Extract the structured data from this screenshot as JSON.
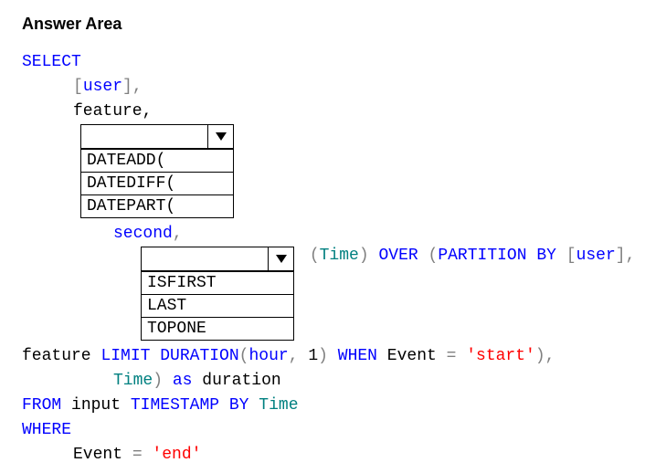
{
  "heading": "Answer Area",
  "sql": {
    "select": "SELECT",
    "user_bracket_open": "[",
    "user_word": "user",
    "user_bracket_close": "]",
    "comma": ",",
    "feature_line": "feature,",
    "second_word": "second",
    "paren_open": "(",
    "time_word": "Time",
    "paren_close": ")",
    "over": "OVER",
    "partition_by": "PARTITION BY",
    "feature_word": "feature",
    "limit_duration": "LIMIT DURATION",
    "hour_word": "hour",
    "one": "1",
    "when": "WHEN",
    "event_word": "Event",
    "equals": " = ",
    "start_str": "'start'",
    "time_as_duration_time": "Time",
    "as": "as",
    "duration_word": "duration",
    "from": "FROM",
    "input_word": "input",
    "timestamp_by": "TIMESTAMP BY",
    "time_word2": "Time",
    "where": "WHERE",
    "event_word2": "Event",
    "end_str": "'end'",
    "space": " "
  },
  "dropdown1": {
    "selected": "",
    "options": [
      "DATEADD(",
      "DATEDIFF(",
      "DATEPART("
    ]
  },
  "dropdown2": {
    "selected": "",
    "options": [
      "ISFIRST",
      "LAST",
      "TOPONE"
    ]
  }
}
